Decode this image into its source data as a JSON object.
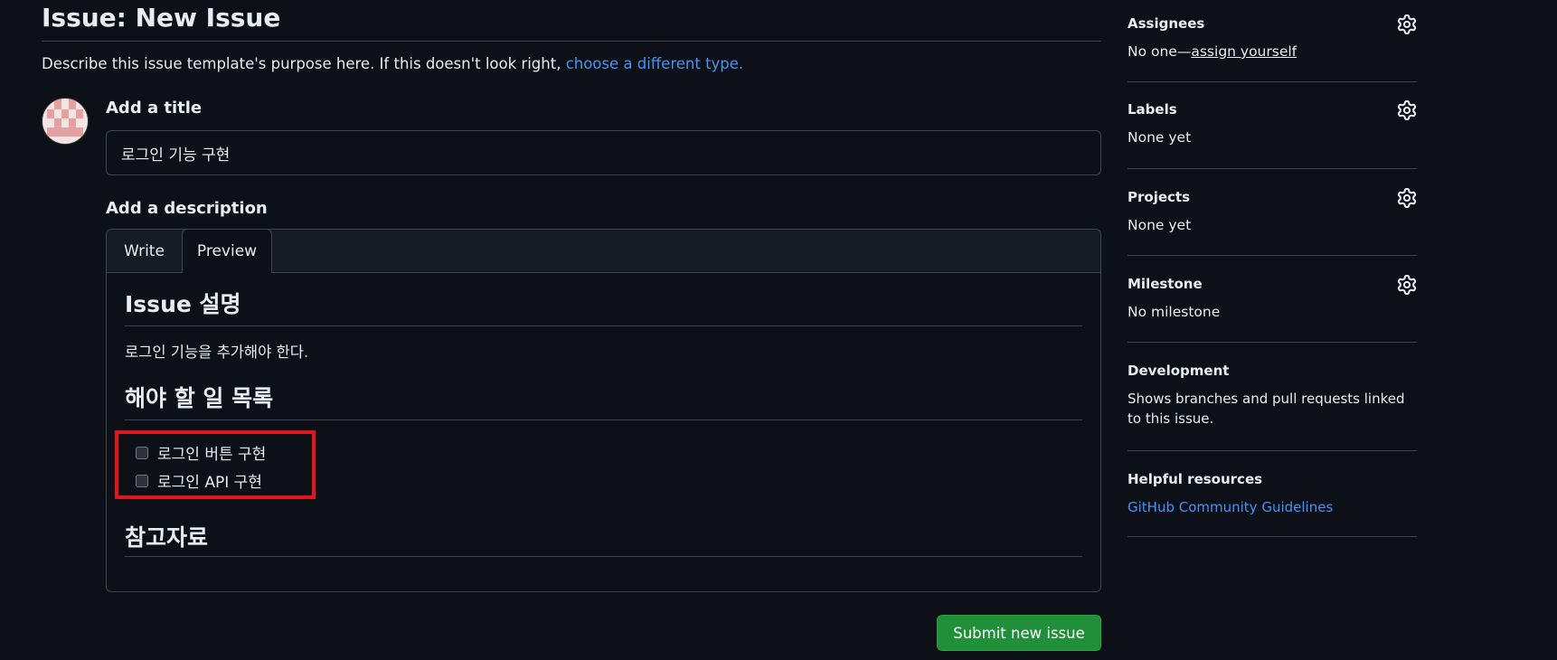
{
  "page": {
    "title": "Issue: New Issue",
    "template_desc": "Describe this issue template's purpose here. If this doesn't look right, ",
    "template_link": "choose a different type."
  },
  "form": {
    "title_label": "Add a title",
    "title_value": "로그인 기능 구현",
    "desc_label": "Add a description",
    "tabs": {
      "write": "Write",
      "preview": "Preview"
    },
    "preview": {
      "heading1": "Issue 설명",
      "paragraph": "로그인 기능을 추가해야 한다.",
      "heading2": "해야 할 일 목록",
      "tasks": [
        {
          "label": "로그인 버튼 구현",
          "checked": false
        },
        {
          "label": "로그인 API 구현",
          "checked": false
        }
      ],
      "heading3": "참고자료"
    },
    "submit_label": "Submit new issue"
  },
  "sidebar": {
    "assignees": {
      "heading": "Assignees",
      "value_prefix": "No one—",
      "value_link": "assign yourself"
    },
    "labels": {
      "heading": "Labels",
      "value": "None yet"
    },
    "projects": {
      "heading": "Projects",
      "value": "None yet"
    },
    "milestone": {
      "heading": "Milestone",
      "value": "No milestone"
    },
    "development": {
      "heading": "Development",
      "value": "Shows branches and pull requests linked to this issue."
    },
    "helpful": {
      "heading": "Helpful resources",
      "link": "GitHub Community Guidelines"
    }
  },
  "colors": {
    "background": "#0d1117",
    "link": "#4493f8",
    "submit": "#1f8f3a",
    "highlight": "#e3151f"
  }
}
